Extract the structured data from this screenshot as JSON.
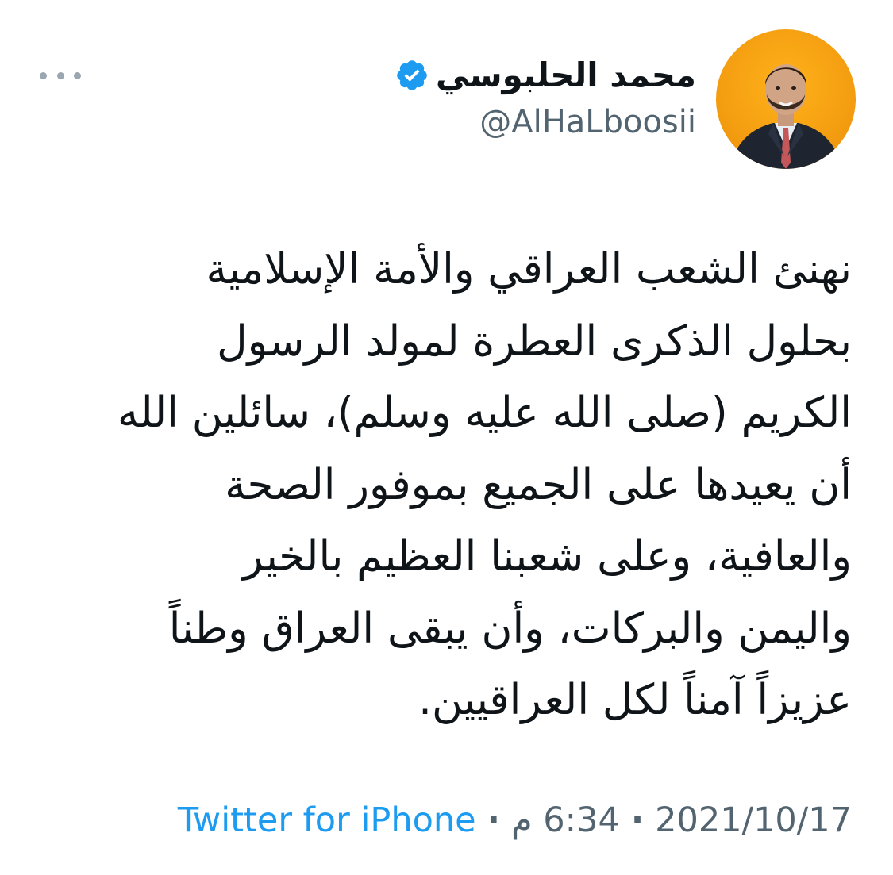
{
  "author": {
    "display_name": "محمد الحلبوسي",
    "handle": "@AlHaLboosii",
    "verified": true
  },
  "tweet": {
    "lines": [
      "نهنئ الشعب العراقي والأمة الإسلامية",
      "بحلول الذكرى العطرة لمولد الرسول",
      "الكريم (صلى الله عليه وسلم)، سائلين الله",
      "أن يعيدها على الجميع بموفور الصحة",
      "والعافية، وعلى شعبنا العظيم بالخير",
      "واليمن والبركات، وأن يبقى العراق وطناً",
      "عزيزاً آمناً لكل العراقيين."
    ]
  },
  "meta": {
    "source": "Twitter for iPhone",
    "separator": "·",
    "time": "6:34 م",
    "date": "2021/10/17"
  },
  "colors": {
    "link": "#1d9bf0",
    "secondary_text": "#536471",
    "verified_badge": "#1d9bf0",
    "avatar_background": "#f29a0f"
  },
  "icons": {
    "more": "more-horizontal-icon",
    "verified": "verified-badge-icon"
  }
}
